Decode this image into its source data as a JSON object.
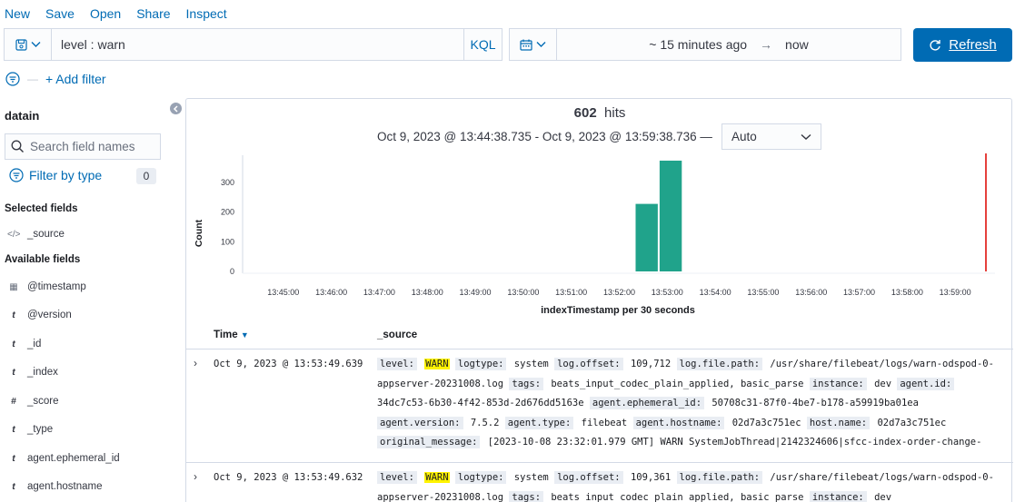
{
  "topmenu": {
    "new": "New",
    "save": "Save",
    "open": "Open",
    "share": "Share",
    "inspect": "Inspect"
  },
  "query": {
    "text": "level : warn",
    "language": "KQL"
  },
  "time": {
    "start": "~ 15 minutes ago",
    "arrow": "→",
    "end": "now"
  },
  "refresh": {
    "label": "Refresh"
  },
  "filters": {
    "dash": "—",
    "add": "+ Add filter"
  },
  "sidebar": {
    "index": "datain",
    "search_placeholder": "Search field names",
    "filter_type": "Filter by type",
    "filter_count": "0",
    "selected_heading": "Selected fields",
    "selected": [
      {
        "type": "</>",
        "name": "_source"
      }
    ],
    "available_heading": "Available fields",
    "available": [
      {
        "type": "▦",
        "name": "@timestamp"
      },
      {
        "type": "t",
        "name": "@version"
      },
      {
        "type": "t",
        "name": "_id"
      },
      {
        "type": "t",
        "name": "_index"
      },
      {
        "type": "#",
        "name": "_score"
      },
      {
        "type": "t",
        "name": "_type"
      },
      {
        "type": "t",
        "name": "agent.ephemeral_id"
      },
      {
        "type": "t",
        "name": "agent.hostname"
      }
    ]
  },
  "summary": {
    "hits_count": "602",
    "hits_label": "hits",
    "interval_text": "Oct 9, 2023 @ 13:44:38.735 - Oct 9, 2023 @ 13:59:38.736 —",
    "interval_select": "Auto"
  },
  "chart_data": {
    "type": "bar",
    "xlabel": "indexTimestamp per 30 seconds",
    "ylabel": "Count",
    "yticks": [
      0,
      100,
      200,
      300
    ],
    "ylim": [
      0,
      380
    ],
    "xticks": [
      "13:45:00",
      "13:46:00",
      "13:47:00",
      "13:48:00",
      "13:49:00",
      "13:50:00",
      "13:51:00",
      "13:52:00",
      "13:53:00",
      "13:54:00",
      "13:55:00",
      "13:56:00",
      "13:57:00",
      "13:58:00",
      "13:59:00"
    ],
    "x_range_minutes": [
      0,
      15.3
    ],
    "bars": [
      {
        "start": "13:53:00",
        "values_minutes": 8.0,
        "value": 228
      },
      {
        "start": "13:53:30",
        "values_minutes": 8.5,
        "value": 374
      }
    ],
    "now_marker_minutes": 15.3,
    "color": "#20a38b",
    "now_color": "#e5413c",
    "grid": false
  },
  "table": {
    "col_time": "Time",
    "col_source": "_source",
    "rows": [
      {
        "time": "Oct 9, 2023 @ 13:53:49.639",
        "fields": [
          {
            "k": "level:",
            "v": "WARN",
            "hl": true
          },
          {
            "k": "logtype:",
            "v": "system"
          },
          {
            "k": "log.offset:",
            "v": "109,712"
          },
          {
            "k": "log.file.path:",
            "v": "/usr/share/filebeat/logs/warn-odspod-0-appserver-20231008.log"
          },
          {
            "k": "tags:",
            "v": "beats_input_codec_plain_applied, basic_parse"
          },
          {
            "k": "instance:",
            "v": "dev"
          },
          {
            "k": "agent.id:",
            "v": "34dc7c53-6b30-4f42-853d-2d676dd5163e"
          },
          {
            "k": "agent.ephemeral_id:",
            "v": "50708c31-87f0-4be7-b178-a59919ba01ea"
          },
          {
            "k": "agent.version:",
            "v": "7.5.2"
          },
          {
            "k": "agent.type:",
            "v": "filebeat"
          },
          {
            "k": "agent.hostname:",
            "v": "02d7a3c751ec"
          },
          {
            "k": "host.name:",
            "v": "02d7a3c751ec"
          },
          {
            "k": "original_message:",
            "v": "[2023-10-08 23:32:01.979 GMT] WARN SystemJobThread|2142324606|sfcc-index-order-change-"
          }
        ]
      },
      {
        "time": "Oct 9, 2023 @ 13:53:49.632",
        "fields": [
          {
            "k": "level:",
            "v": "WARN",
            "hl": true
          },
          {
            "k": "logtype:",
            "v": "system"
          },
          {
            "k": "log.offset:",
            "v": "109,361"
          },
          {
            "k": "log.file.path:",
            "v": "/usr/share/filebeat/logs/warn-odspod-0-appserver-20231008.log"
          },
          {
            "k": "tags:",
            "v": "beats_input_codec_plain_applied, basic_parse"
          },
          {
            "k": "instance:",
            "v": "dev"
          }
        ]
      }
    ]
  }
}
